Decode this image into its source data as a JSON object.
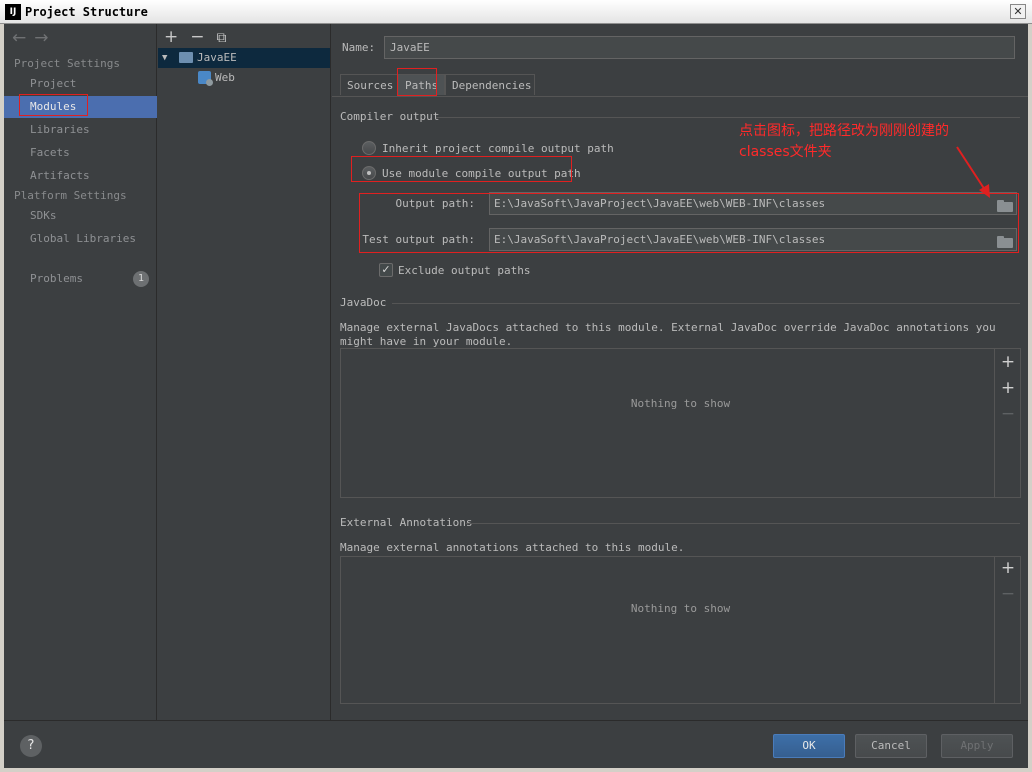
{
  "window": {
    "title": "Project Structure",
    "app_icon": "IJ",
    "close_label": "✕"
  },
  "sidebar": {
    "back_icon": "←",
    "forward_icon": "→",
    "project_settings_header": "Project Settings",
    "project_settings_items": [
      "Project",
      "Modules",
      "Libraries",
      "Facets",
      "Artifacts"
    ],
    "selected_item": "Modules",
    "platform_settings_header": "Platform Settings",
    "platform_settings_items": [
      "SDKs",
      "Global Libraries"
    ],
    "problems_label": "Problems",
    "problems_count": "1"
  },
  "tree": {
    "add_icon": "+",
    "remove_icon": "−",
    "copy_icon": "⧉",
    "expand_icon": "▼",
    "module_name": "JavaEE",
    "facet_name": "Web"
  },
  "module": {
    "name_label": "Name:",
    "name_value": "JavaEE",
    "tabs": [
      "Sources",
      "Paths",
      "Dependencies"
    ],
    "selected_tab": "Paths"
  },
  "compiler_output": {
    "title": "Compiler output",
    "inherit_label": "Inherit project compile output path",
    "use_module_label": "Use module compile output path",
    "selected_option": "Use module compile output path",
    "output_path_label": "Output path:",
    "output_path_value": "E:\\JavaSoft\\JavaProject\\JavaEE\\web\\WEB-INF\\classes",
    "test_output_path_label": "Test output path:",
    "test_output_path_value": "E:\\JavaSoft\\JavaProject\\JavaEE\\web\\WEB-INF\\classes",
    "exclude_label": "Exclude output paths",
    "exclude_checked": true
  },
  "javadoc": {
    "title": "JavaDoc",
    "description": "Manage external JavaDocs attached to this module. External JavaDoc override JavaDoc annotations you might have in your module.",
    "empty_text": "Nothing to show",
    "add_icon": "+",
    "add_url_icon": "+",
    "remove_icon": "−"
  },
  "external_annotations": {
    "title": "External Annotations",
    "description": "Manage external annotations attached to this module.",
    "empty_text": "Nothing to show",
    "add_icon": "+",
    "remove_icon": "−"
  },
  "buttons": {
    "help": "?",
    "ok": "OK",
    "cancel": "Cancel",
    "apply": "Apply"
  },
  "annotation": {
    "text": "点击图标，把路径改为刚刚创建的classes文件夹",
    "color": "#ff2a2a"
  },
  "colors": {
    "selection": "#4b6eaf",
    "background": "#3c3f41",
    "ok_button": "#3d6fa8"
  }
}
